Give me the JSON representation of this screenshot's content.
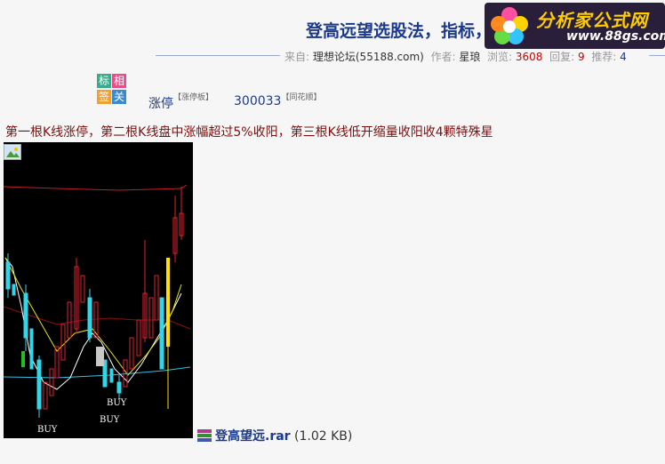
{
  "header": {
    "title": "登高远望选股法，指标",
    "title_tail": "，",
    "logo_main": "分析家公式网",
    "logo_url": "www.88gs.com",
    "logo_icon": "flower-icon"
  },
  "meta": {
    "from_label": "来自:",
    "from_value": "理想论坛(55188.com)",
    "author_label": "作者:",
    "author_value": "星琅",
    "views_label": "浏览:",
    "views_value": "3608",
    "replies_label": "回复:",
    "replies_value": "9",
    "recommend_label": "推荐:",
    "recommend_value": "4"
  },
  "tags": {
    "t1": "标",
    "t2": "相",
    "t3": "签",
    "t4": "关"
  },
  "keywords": [
    {
      "label": "涨停",
      "source": "【涨停板】"
    },
    {
      "label": "300033",
      "source": "【同花顺】"
    }
  ],
  "description": "第一根K线涨停，第二根K线盘中涨幅超过5%收阳，第三根K线低开缩量收阳收4颗特殊星",
  "chart_labels": {
    "buy1": "BUY",
    "buy2": "BUY",
    "buy3": "BUY"
  },
  "attachment": {
    "icon": "rar-archive-icon",
    "filename": "登高望远.rar",
    "size": "(1.02 KB)"
  }
}
